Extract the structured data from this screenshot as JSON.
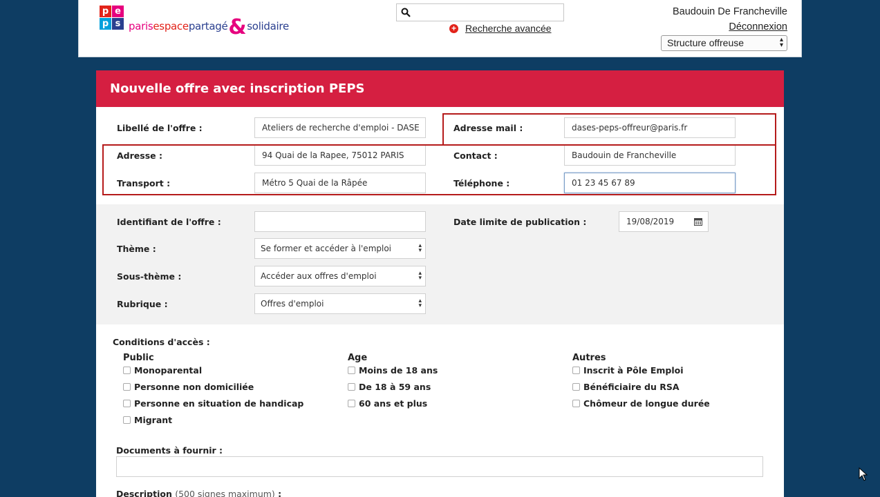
{
  "header": {
    "logo": {
      "squares": [
        "p",
        "e",
        "p",
        "s"
      ],
      "text_paris": "paris",
      "text_espace": "espace",
      "text_partage": "partagé",
      "text_amp": "&",
      "text_solidaire": "solidaire"
    },
    "search": {
      "value": "",
      "icon": "search-icon"
    },
    "advanced_search_label": "Recherche avancée",
    "user_name": "Baudouin De Francheville",
    "logout_label": "Déconnexion",
    "role_select": "Structure offreuse"
  },
  "form": {
    "title": "Nouvelle offre avec inscription PEPS",
    "fields": {
      "libelle": {
        "label": "Libellé de l'offre :",
        "value": "Ateliers de recherche d'emploi - DASE"
      },
      "adresse_mail": {
        "label": "Adresse mail :",
        "value": "dases-peps-offreur@paris.fr"
      },
      "adresse": {
        "label": "Adresse :",
        "value": "94 Quai de la Rapee, 75012 PARIS"
      },
      "contact": {
        "label": "Contact :",
        "value": "Baudouin de Francheville"
      },
      "transport": {
        "label": "Transport :",
        "value": "Métro 5 Quai de la Râpée"
      },
      "telephone": {
        "label": "Téléphone :",
        "value": "01 23 45 67 89"
      },
      "identifiant": {
        "label": "Identifiant de l'offre :",
        "value": ""
      },
      "date_limite": {
        "label": "Date limite de publication :",
        "value": "19/08/2019"
      },
      "theme": {
        "label": "Thème :",
        "value": "Se former et accéder à l'emploi"
      },
      "sous_theme": {
        "label": "Sous-thème :",
        "value": "Accéder aux offres d'emploi"
      },
      "rubrique": {
        "label": "Rubrique :",
        "value": "Offres d'emploi"
      }
    },
    "conditions": {
      "title": "Conditions d'accès :",
      "columns": [
        {
          "title": "Public",
          "items": [
            "Monoparental",
            "Personne non domiciliée",
            "Personne en situation de handicap",
            "Migrant"
          ]
        },
        {
          "title": "Age",
          "items": [
            "Moins de 18 ans",
            "De 18 à 59 ans",
            "60 ans et plus"
          ]
        },
        {
          "title": "Autres",
          "items": [
            "Inscrit à Pôle Emploi",
            "Bénéficiaire du RSA",
            "Chômeur de longue durée"
          ]
        }
      ]
    },
    "documents": {
      "label": "Documents à fournir :",
      "value": ""
    },
    "description": {
      "label": "Description",
      "note": "(500 signes maximum)",
      "suffix": " :"
    }
  },
  "colors": {
    "background": "#0e3d63",
    "header_bar": "#d51f41",
    "highlight_box": "#b51a1a"
  }
}
